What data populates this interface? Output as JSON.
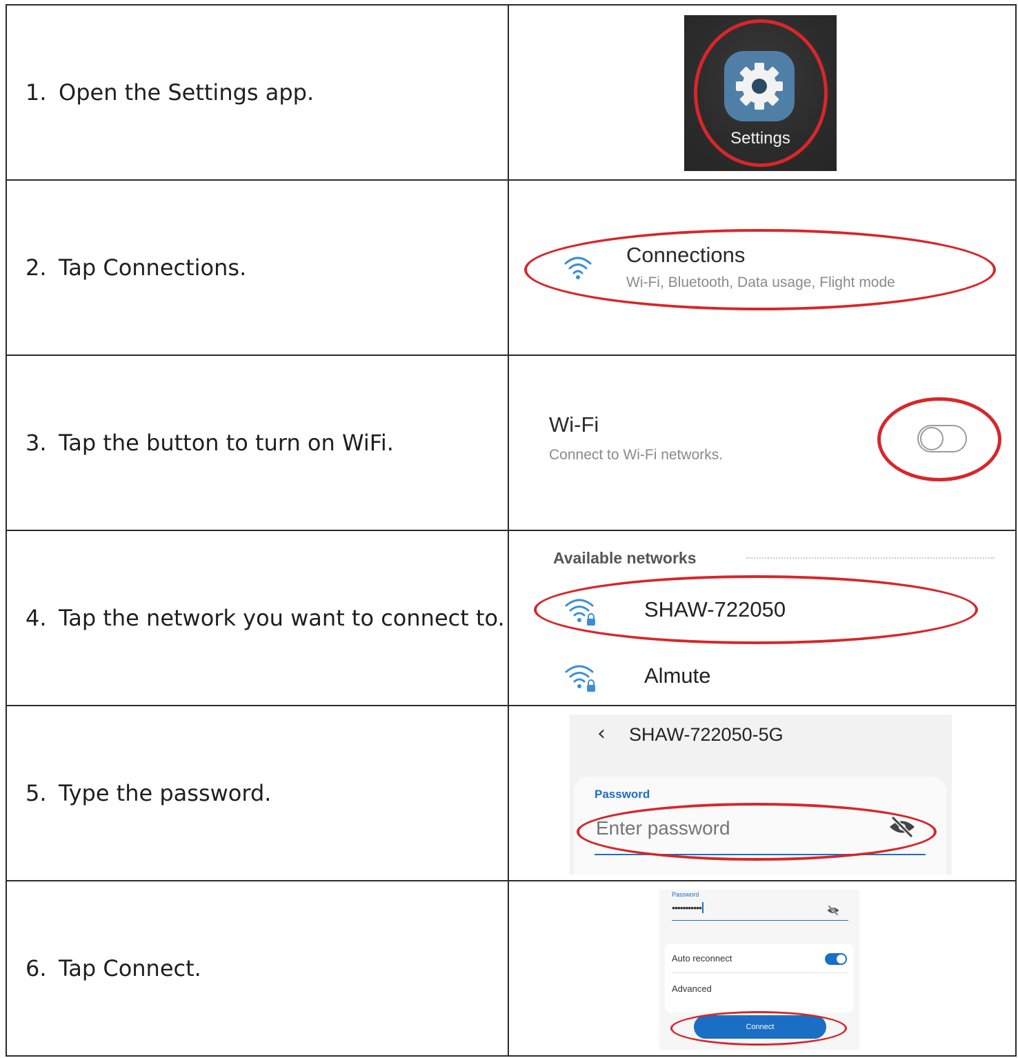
{
  "steps": [
    {
      "num": "1.",
      "text": "Open the Settings app."
    },
    {
      "num": "2.",
      "text": "Tap Connections."
    },
    {
      "num": "3.",
      "text": "Tap the button to turn on WiFi."
    },
    {
      "num": "4.",
      "text": "Tap the network you want to connect to."
    },
    {
      "num": "5.",
      "text": "Type the password."
    },
    {
      "num": "6.",
      "text": "Tap Connect."
    }
  ],
  "shot1": {
    "label": "Settings",
    "icon": "gear-icon"
  },
  "shot2": {
    "title": "Connections",
    "subtitle": "Wi-Fi, Bluetooth, Data usage, Flight mode",
    "icon": "wifi-icon"
  },
  "shot3": {
    "title": "Wi-Fi",
    "subtitle": "Connect to Wi-Fi networks.",
    "toggle_on": false
  },
  "shot4": {
    "header": "Available networks",
    "networks": [
      "SHAW-722050",
      "Almute"
    ]
  },
  "shot5": {
    "network": "SHAW-722050-5G",
    "field_label": "Password",
    "placeholder": "Enter password"
  },
  "shot6": {
    "field_label": "Password",
    "password_mask": "•••••••••••",
    "auto_reconnect": "Auto reconnect",
    "advanced": "Advanced",
    "connect": "Connect",
    "auto_reconnect_on": true
  },
  "colors": {
    "annotation_red": "#d8262a",
    "accent_blue": "#1a6fc4"
  }
}
